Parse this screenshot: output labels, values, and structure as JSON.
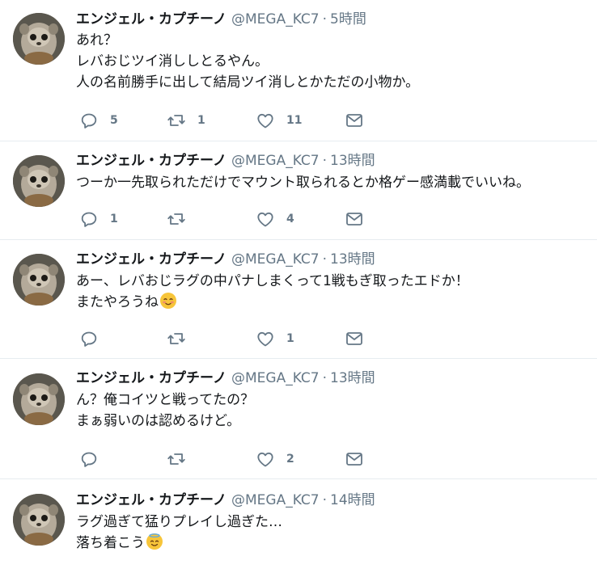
{
  "user": {
    "name": "エンジェル・カプチーノ",
    "handle": "@MEGA_KC7",
    "separator": "·"
  },
  "colors": {
    "text": "#14171a",
    "secondary": "#657786",
    "divider": "#e6ecf0",
    "emoji": "#f7c53a"
  },
  "icons": [
    "reply-icon",
    "retweet-icon",
    "like-icon",
    "dm-icon",
    "blush-emoji-icon",
    "halo-emoji-icon"
  ],
  "tweets": [
    {
      "time": "5時間",
      "lines": [
        "あれ？",
        "レバおじツイ消ししとるやん。",
        "人の名前勝手に出して結局ツイ消しとかただの小物か。"
      ],
      "replies": "5",
      "retweets": "1",
      "likes": "11"
    },
    {
      "time": "13時間",
      "lines": [
        "つーか一先取られただけでマウント取られるとか格ゲー感満載でいいね。"
      ],
      "replies": "1",
      "retweets": "",
      "likes": "4"
    },
    {
      "time": "13時間",
      "lines": [
        "あー、レバおじラグの中パナしまくって1戦もぎ取ったエドか！",
        "またやろうね"
      ],
      "replies": "",
      "retweets": "",
      "likes": "1"
    },
    {
      "time": "13時間",
      "lines": [
        "ん？俺コイツと戦ってたの？",
        "まぁ弱いのは認めるけど。"
      ],
      "replies": "",
      "retweets": "",
      "likes": "2"
    },
    {
      "time": "14時間",
      "lines": [
        "ラグ過ぎて猛りプレイし過ぎた…",
        "落ち着こう"
      ],
      "replies": "",
      "retweets": "",
      "likes": ""
    }
  ]
}
